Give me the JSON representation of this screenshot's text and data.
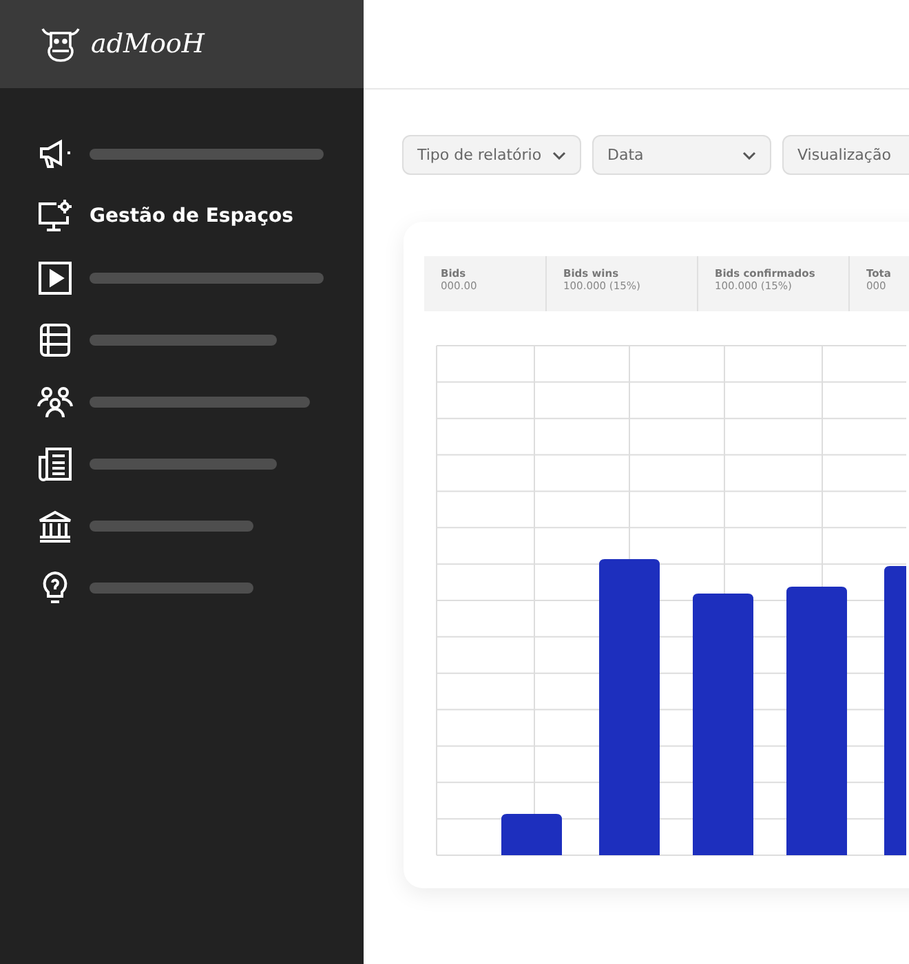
{
  "logo": {
    "text": "adMooH"
  },
  "sidebar": {
    "items": [
      {
        "kind": "skeleton",
        "selected": false
      },
      {
        "kind": "label",
        "label": "Gestão de Espaços",
        "selected": true
      },
      {
        "kind": "skeleton",
        "selected": false
      },
      {
        "kind": "skeleton",
        "selected": false
      },
      {
        "kind": "skeleton",
        "selected": false
      },
      {
        "kind": "skeleton",
        "selected": false
      },
      {
        "kind": "skeleton",
        "selected": false
      },
      {
        "kind": "skeleton",
        "selected": false
      }
    ]
  },
  "filters": [
    {
      "label": "Tipo de relatório"
    },
    {
      "label": "Data"
    },
    {
      "label": "Visualização"
    }
  ],
  "stats": [
    {
      "title": "Bids",
      "value": "000.00"
    },
    {
      "title": "Bids wins",
      "value": "100.000 (15%)"
    },
    {
      "title": "Bids confirmados",
      "value": "100.000 (15%)"
    },
    {
      "title": "Tota",
      "value": "000"
    }
  ]
}
